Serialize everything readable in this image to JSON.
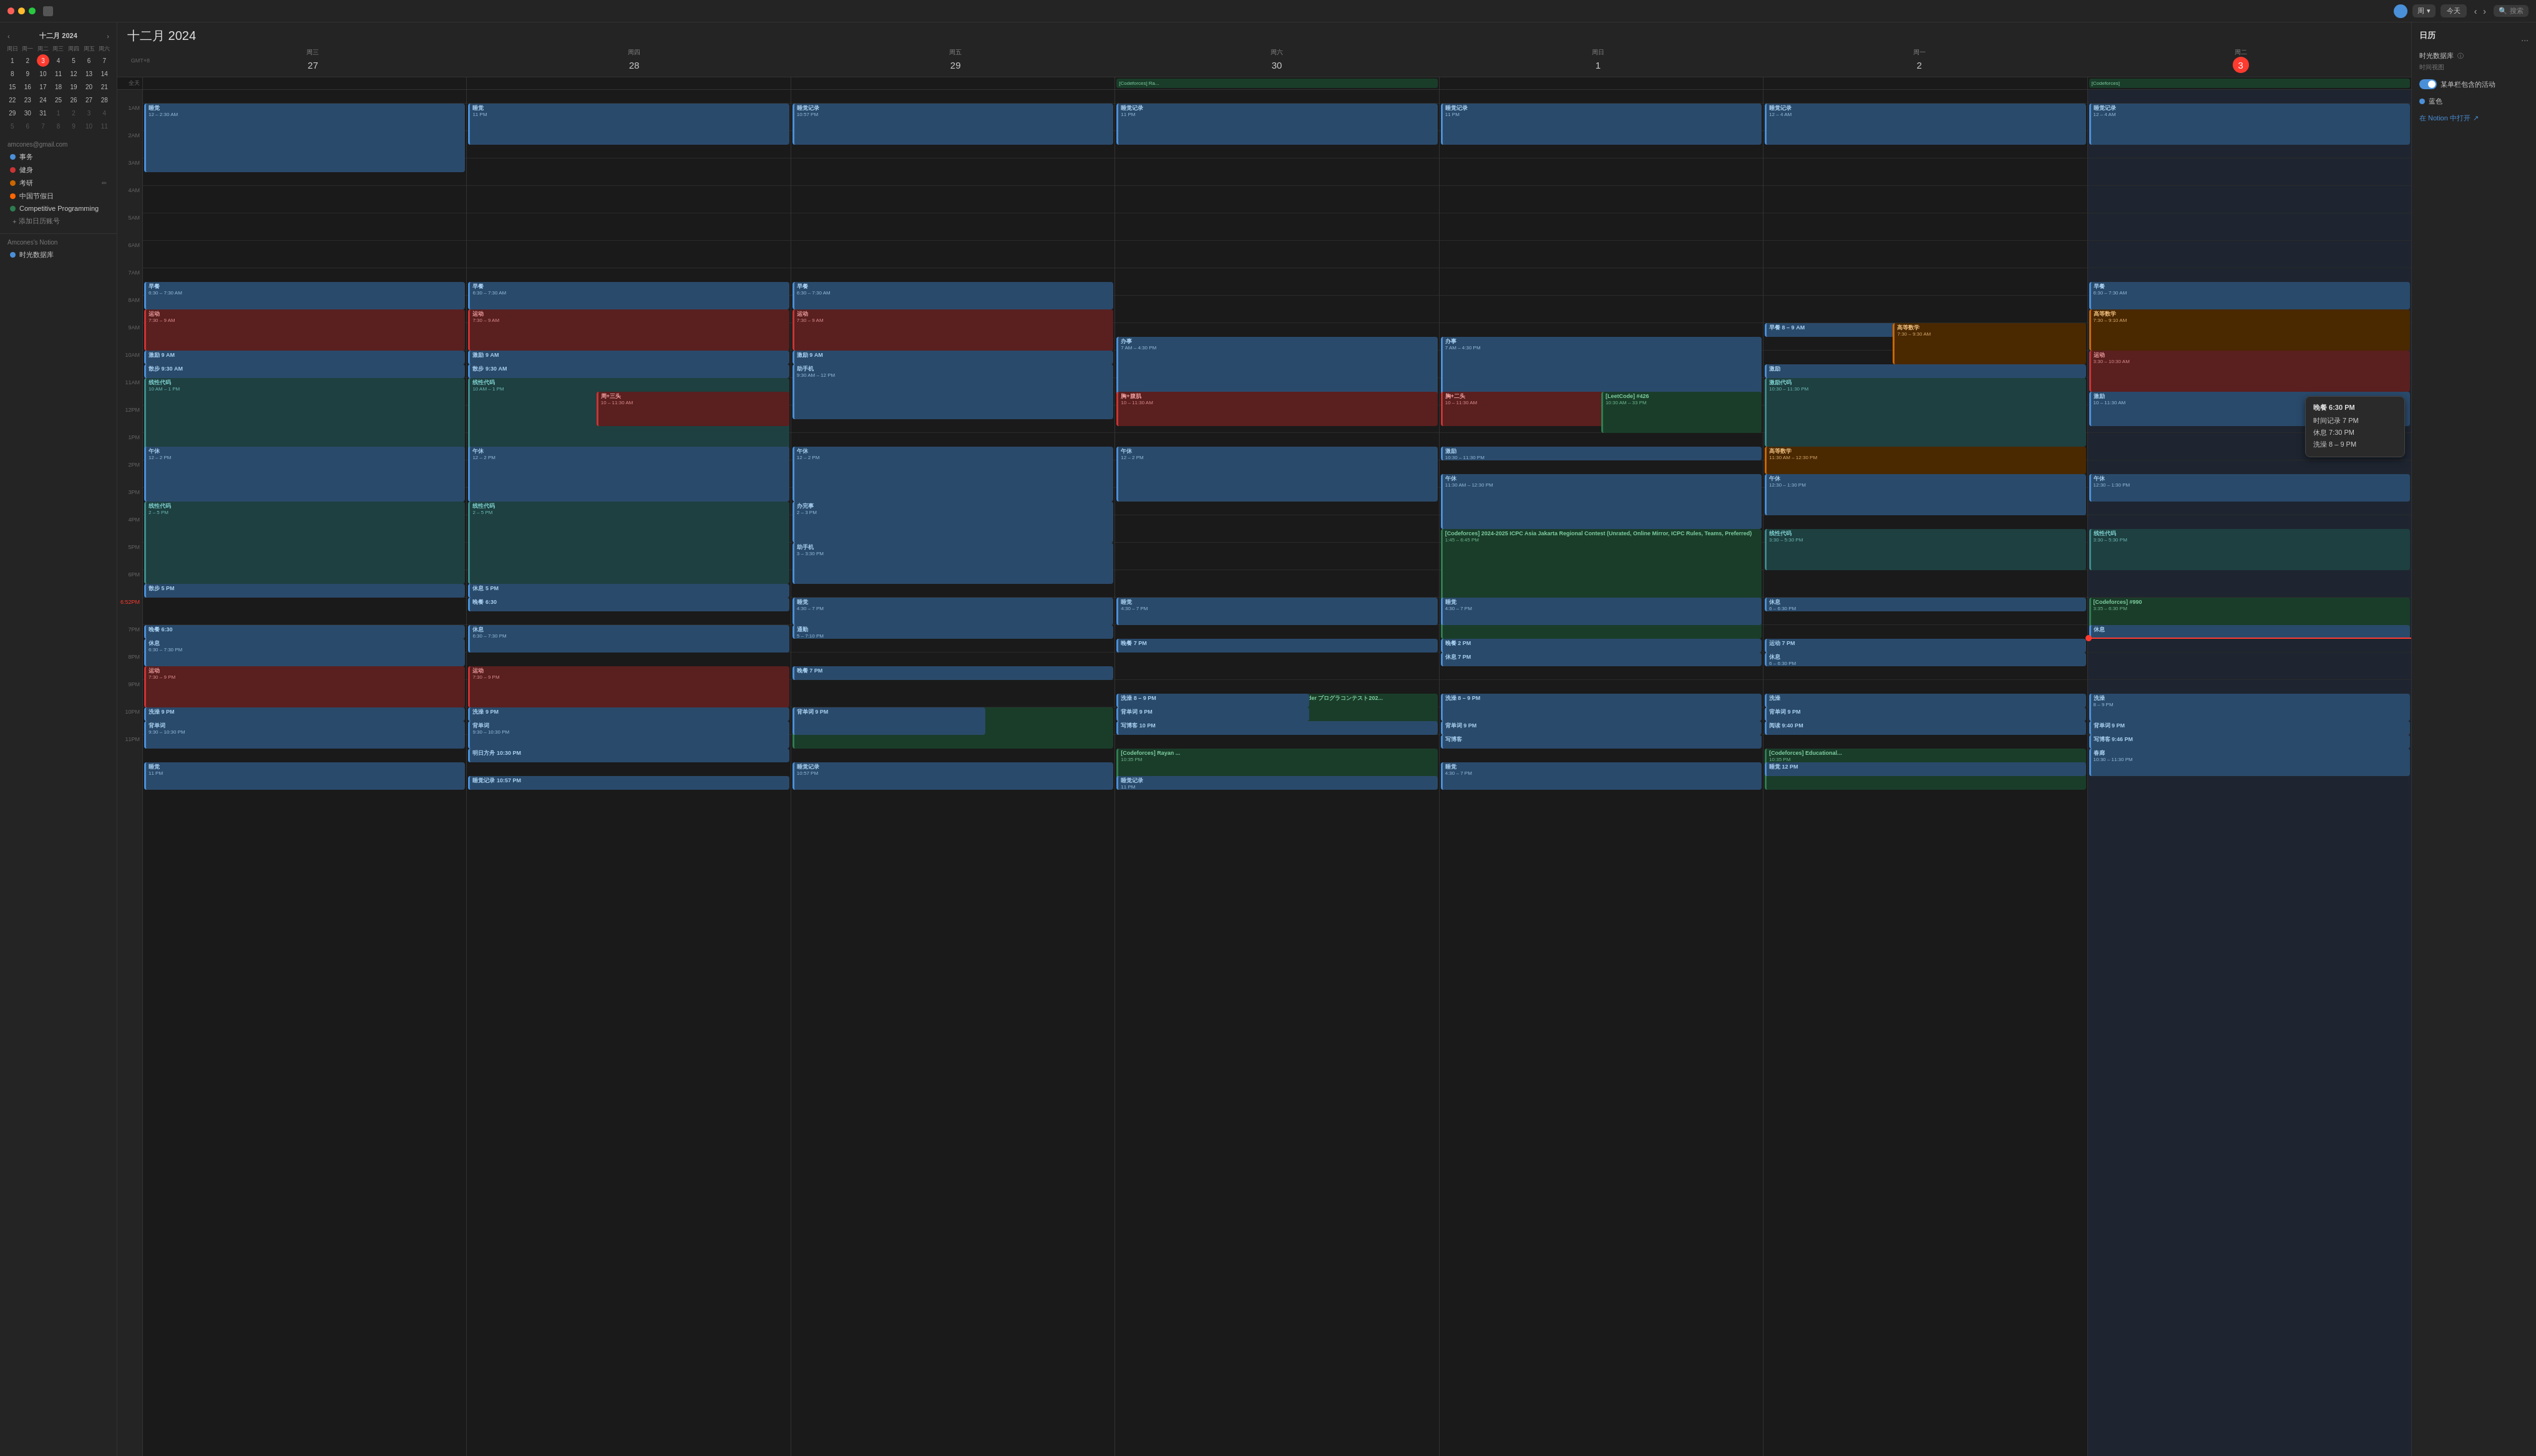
{
  "app": {
    "title": "十二月 2024",
    "month_year": "十二月 2024"
  },
  "topbar": {
    "week_label": "周",
    "today_label": "今天",
    "search_placeholder": "搜索"
  },
  "mini_cal": {
    "header": "十二月 2024",
    "day_headers": [
      "周日",
      "周一",
      "周二",
      "周三",
      "周四",
      "周五",
      "周六"
    ],
    "days": [
      {
        "label": "1",
        "type": "normal"
      },
      {
        "label": "2",
        "type": "normal"
      },
      {
        "label": "3",
        "type": "today"
      },
      {
        "label": "4",
        "type": "normal"
      },
      {
        "label": "5",
        "type": "normal"
      },
      {
        "label": "6",
        "type": "normal"
      },
      {
        "label": "7",
        "type": "normal"
      },
      {
        "label": "8",
        "type": "normal"
      },
      {
        "label": "9",
        "type": "normal"
      },
      {
        "label": "10",
        "type": "normal"
      },
      {
        "label": "11",
        "type": "normal"
      },
      {
        "label": "12",
        "type": "normal"
      },
      {
        "label": "13",
        "type": "normal"
      },
      {
        "label": "14",
        "type": "normal"
      },
      {
        "label": "15",
        "type": "normal"
      },
      {
        "label": "16",
        "type": "normal"
      },
      {
        "label": "17",
        "type": "normal"
      },
      {
        "label": "18",
        "type": "normal"
      },
      {
        "label": "19",
        "type": "normal"
      },
      {
        "label": "20",
        "type": "normal"
      },
      {
        "label": "21",
        "type": "normal"
      },
      {
        "label": "22",
        "type": "normal"
      },
      {
        "label": "23",
        "type": "normal"
      },
      {
        "label": "24",
        "type": "normal"
      },
      {
        "label": "25",
        "type": "normal"
      },
      {
        "label": "26",
        "type": "normal"
      },
      {
        "label": "27",
        "type": "normal"
      },
      {
        "label": "28",
        "type": "normal"
      },
      {
        "label": "29",
        "type": "normal"
      },
      {
        "label": "30",
        "type": "normal"
      },
      {
        "label": "31",
        "type": "normal"
      },
      {
        "label": "1",
        "type": "other"
      },
      {
        "label": "2",
        "type": "other"
      },
      {
        "label": "3",
        "type": "other"
      },
      {
        "label": "4",
        "type": "other"
      },
      {
        "label": "5",
        "type": "other"
      },
      {
        "label": "6",
        "type": "other"
      },
      {
        "label": "7",
        "type": "other"
      },
      {
        "label": "8",
        "type": "other"
      },
      {
        "label": "9",
        "type": "other"
      },
      {
        "label": "10",
        "type": "other"
      },
      {
        "label": "11",
        "type": "other"
      }
    ]
  },
  "calendars": {
    "account": "amcones@gmail.com",
    "items": [
      {
        "label": "事务",
        "color": "#4a90d9"
      },
      {
        "label": "健身",
        "color": "#cc3333"
      },
      {
        "label": "考研",
        "color": "#cc6600"
      },
      {
        "label": "中国节假日",
        "color": "#ff6600"
      },
      {
        "label": "Competitive Programming",
        "color": "#2e7d4f"
      }
    ],
    "add_label": "+ 添加日历账号"
  },
  "notion": {
    "title": "Amcones's Notion",
    "items": [
      {
        "label": "时光数据库",
        "color": "#4a90d9"
      }
    ]
  },
  "week_header": {
    "gmt": "GMT+8",
    "all_day": "全天",
    "days": [
      {
        "day": "周三",
        "date": "27",
        "is_today": false
      },
      {
        "day": "周四",
        "date": "28",
        "is_today": false
      },
      {
        "day": "周五",
        "date": "29",
        "is_today": false
      },
      {
        "day": "周六",
        "date": "30",
        "is_today": false
      },
      {
        "day": "周日",
        "date": "1",
        "is_today": false
      },
      {
        "day": "周一",
        "date": "2",
        "is_today": false
      },
      {
        "day": "周二",
        "date": "3",
        "is_today": true
      }
    ]
  },
  "right_panel": {
    "title": "日历",
    "more_btn": "...",
    "datasource_label": "时光数据库",
    "datasource_info": "时间视图",
    "toggle_label": "某单栏包含的活动",
    "color_label": "蓝色",
    "notion_link": "在 Notion 中打开"
  },
  "popup": {
    "title": "晚餐 6:30 PM",
    "items": [
      "时间记录 7 PM",
      "休息 7:30 PM",
      "洗澡 8 - 9 PM"
    ]
  },
  "times": [
    "1AM",
    "2AM",
    "3AM",
    "4AM",
    "5AM",
    "6AM",
    "7AM",
    "8AM",
    "9AM",
    "10AM",
    "11AM",
    "12PM",
    "1PM",
    "2PM",
    "3PM",
    "4PM",
    "5PM",
    "6PM",
    "7PM",
    "8PM",
    "9PM",
    "10PM",
    "11PM"
  ]
}
